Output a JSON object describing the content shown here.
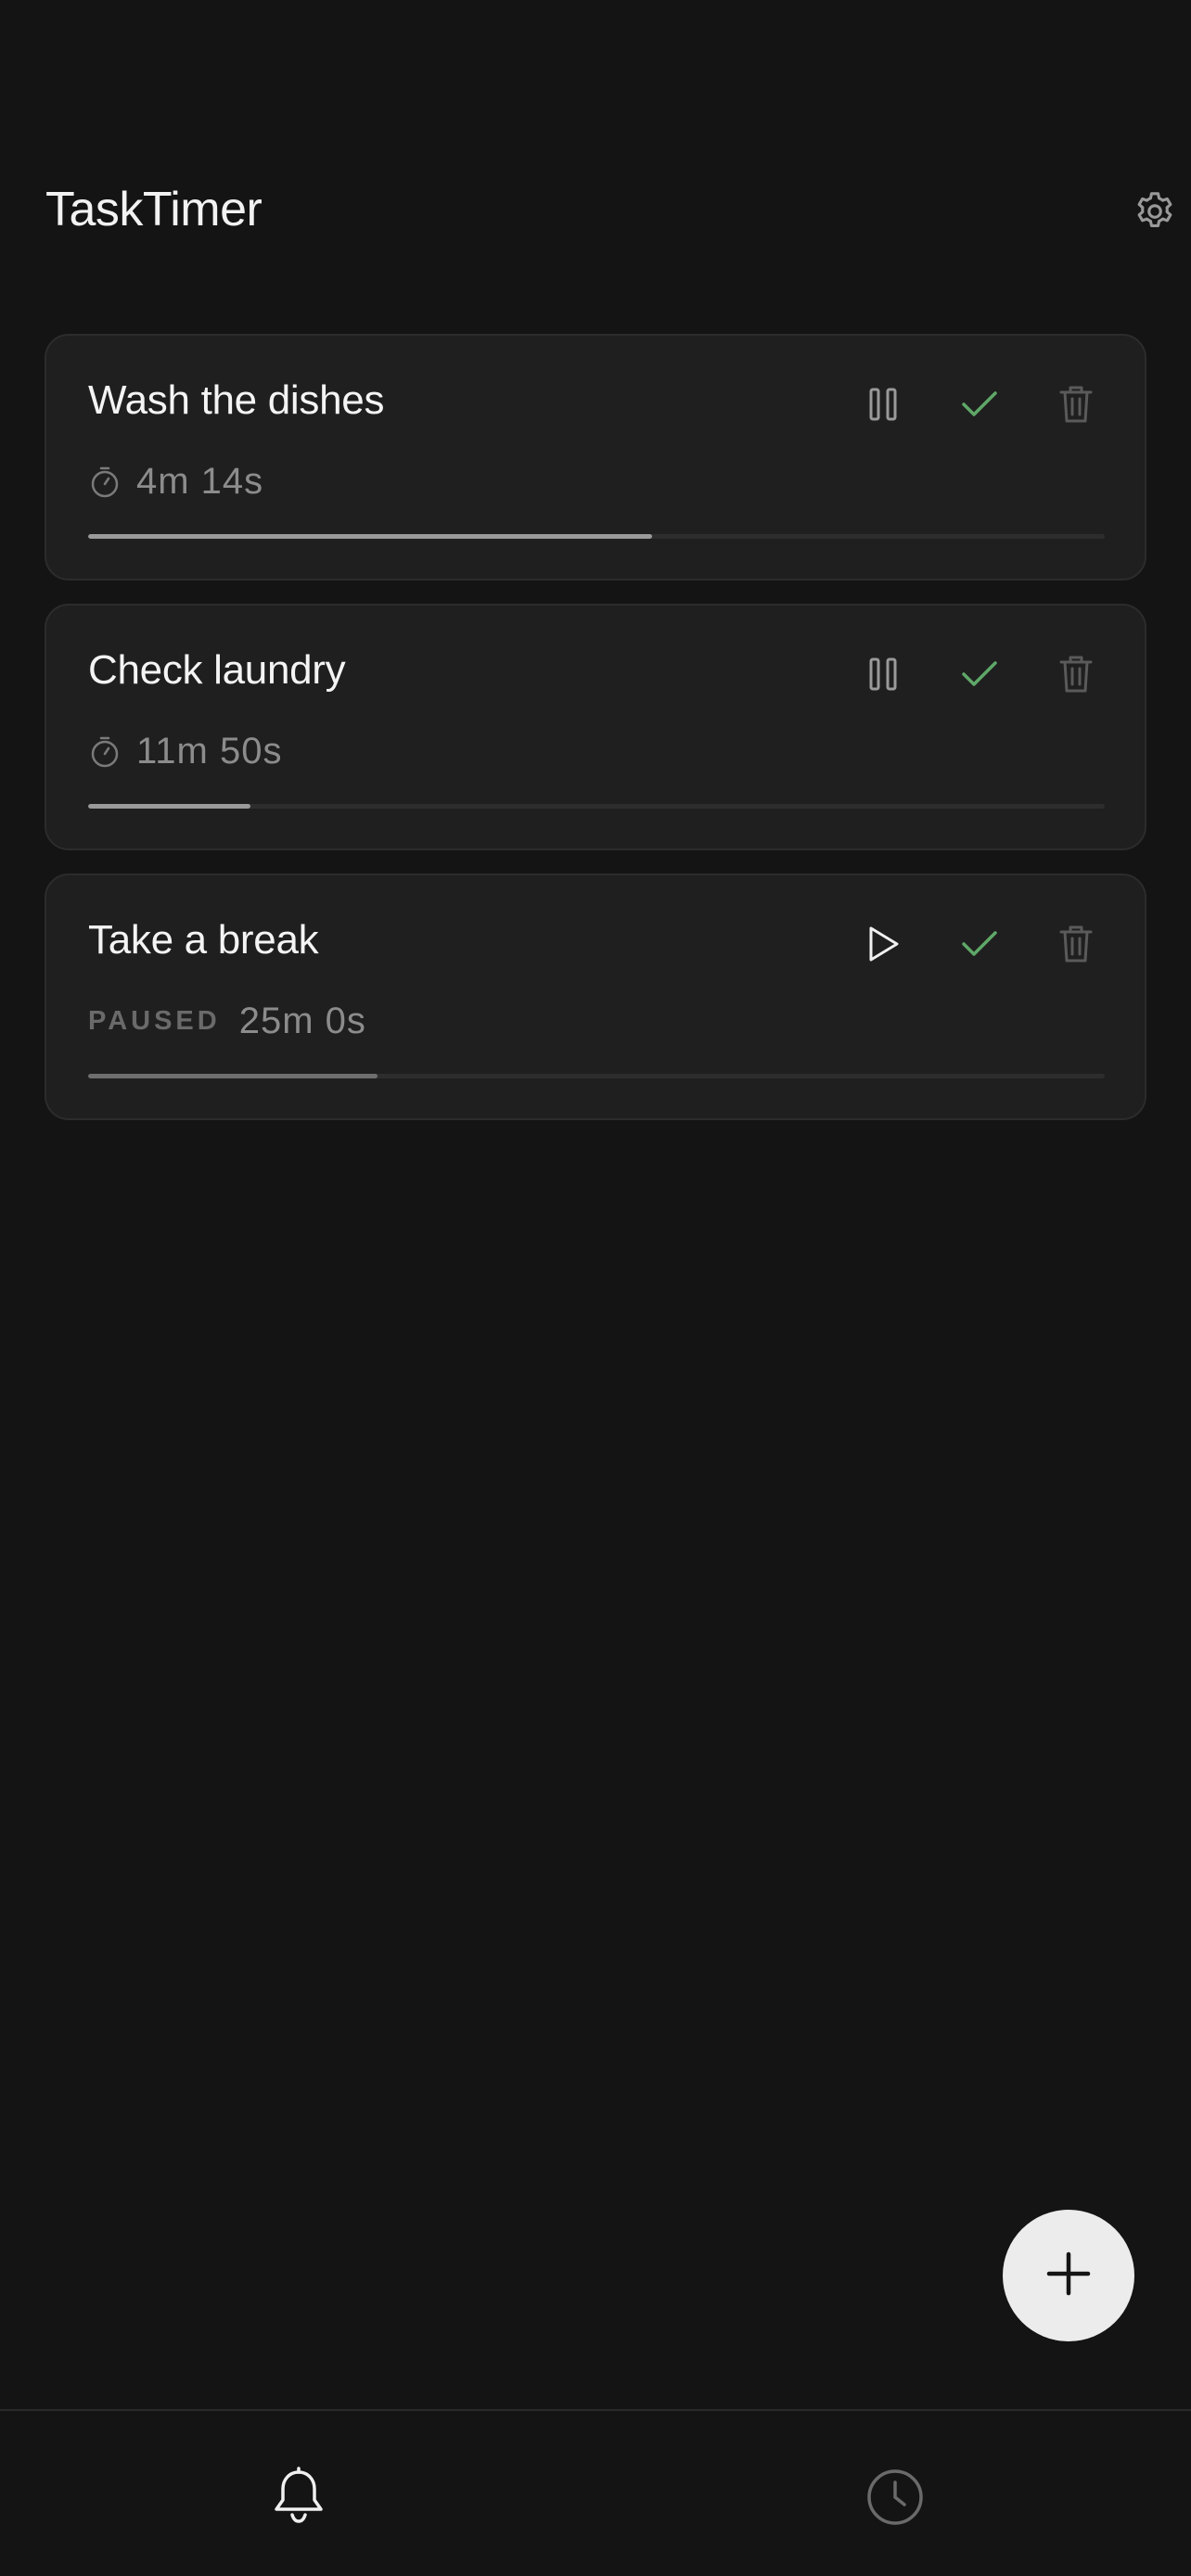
{
  "app": {
    "title": "TaskTimer"
  },
  "header": {
    "settings_icon": "gear-icon"
  },
  "tasks": [
    {
      "name": "Wash the dishes",
      "status": "running",
      "status_label": "",
      "time": "4m 14s",
      "progress": 0.555,
      "primary_action_icon": "pause-icon"
    },
    {
      "name": "Check laundry",
      "status": "running",
      "status_label": "",
      "time": "11m 50s",
      "progress": 0.16,
      "primary_action_icon": "pause-icon"
    },
    {
      "name": "Take a break",
      "status": "paused",
      "status_label": "PAUSED",
      "time": "25m 0s",
      "progress": 0.285,
      "primary_action_icon": "play-icon"
    }
  ],
  "fab": {
    "icon": "plus-icon"
  },
  "bottom_nav": [
    {
      "icon": "bell-icon",
      "active": true
    },
    {
      "icon": "clock-icon",
      "active": false
    }
  ],
  "colors": {
    "background": "#141414",
    "card": "#1f1f1f",
    "complete_check": "#5fa868",
    "fab": "#ececec"
  }
}
